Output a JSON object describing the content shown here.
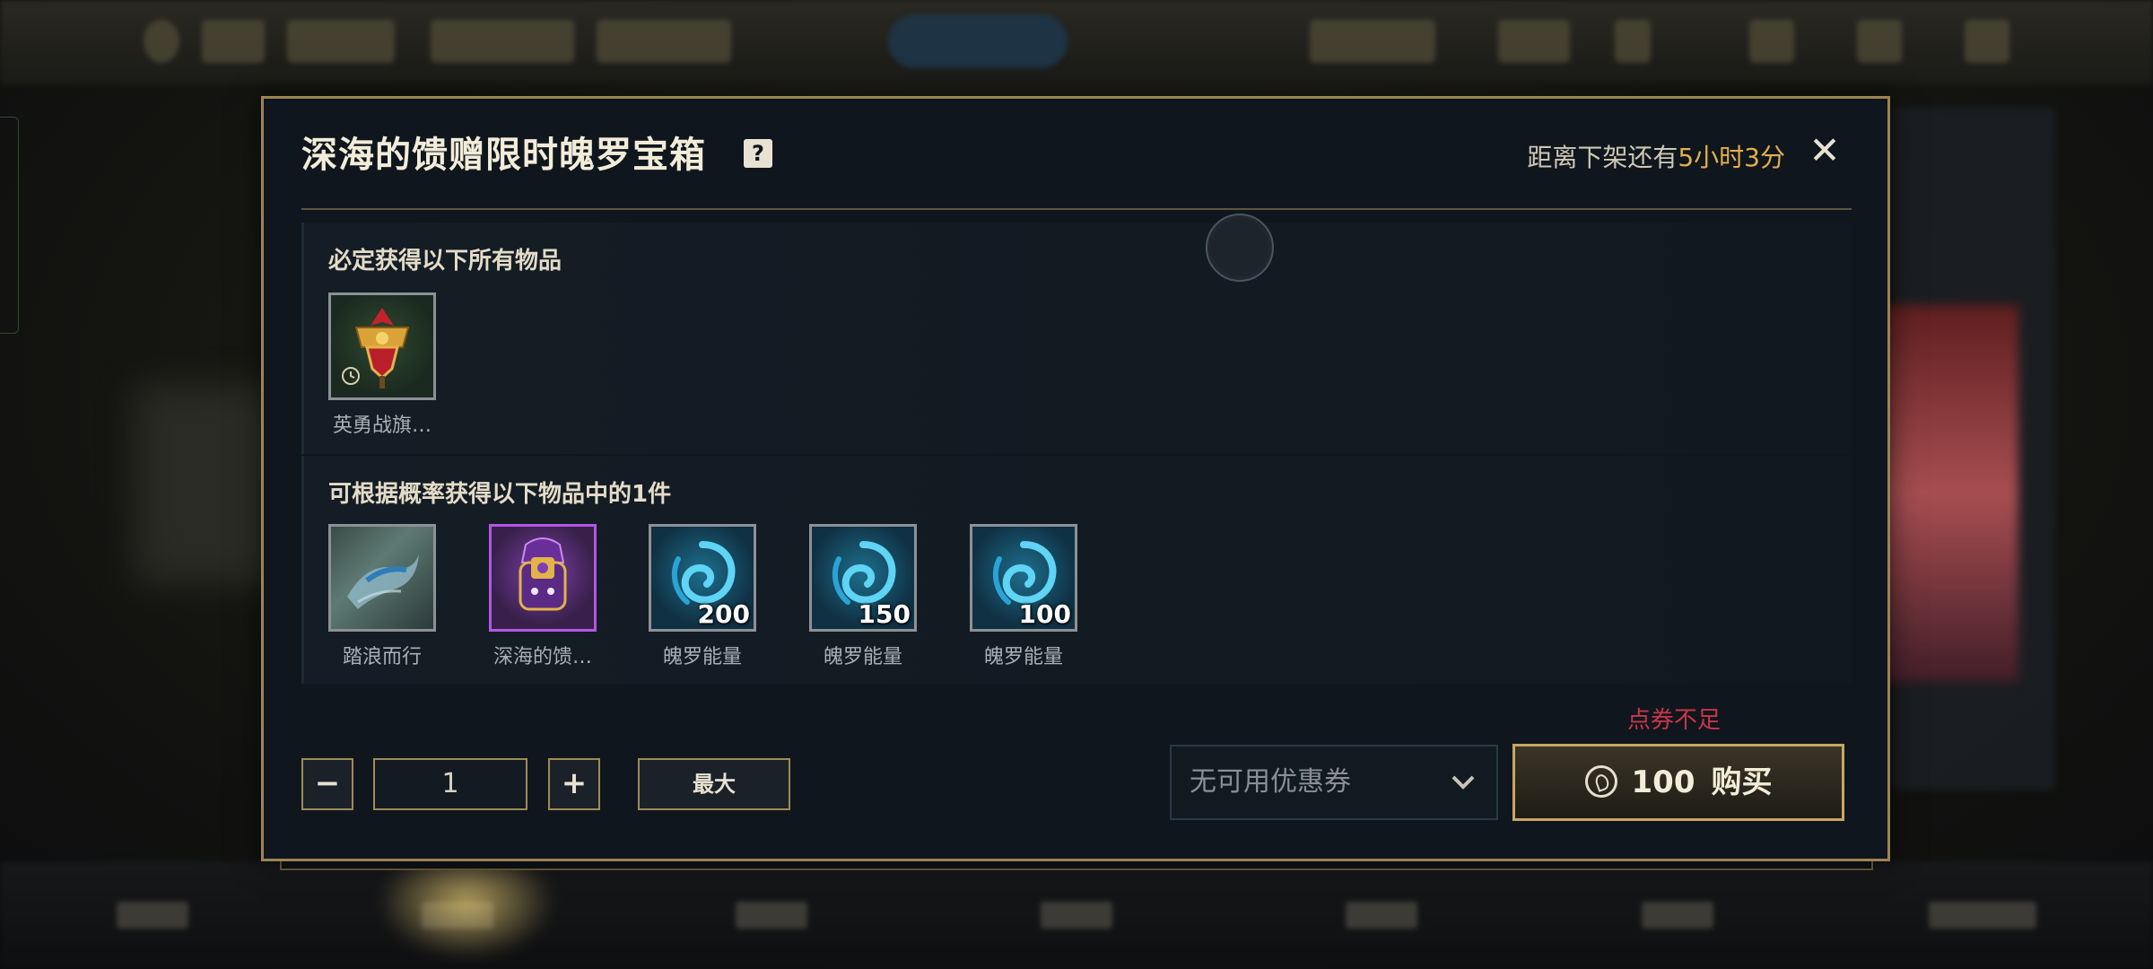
{
  "modal": {
    "title": "深海的馈赠限时魄罗宝箱",
    "help_glyph": "?",
    "timer_prefix": "距离下架还有",
    "timer_value": "5小时3分",
    "close_glyph": "✕"
  },
  "guaranteed": {
    "title": "必定获得以下所有物品",
    "items": [
      {
        "label": "英勇战旗…",
        "icon": "flag-banner-icon"
      }
    ]
  },
  "random": {
    "title": "可根据概率获得以下物品中的1件",
    "items": [
      {
        "label": "踏浪而行",
        "icon": "wave-skin-icon",
        "quantity": ""
      },
      {
        "label": "深海的馈…",
        "icon": "epic-chest-icon",
        "quantity": ""
      },
      {
        "label": "魄罗能量",
        "icon": "poro-energy-icon",
        "quantity": "200"
      },
      {
        "label": "魄罗能量",
        "icon": "poro-energy-icon",
        "quantity": "150"
      },
      {
        "label": "魄罗能量",
        "icon": "poro-energy-icon",
        "quantity": "100"
      }
    ]
  },
  "controls": {
    "minus": "−",
    "quantity": "1",
    "plus": "+",
    "max_label": "最大",
    "coupon_placeholder": "无可用优惠券",
    "warning": "点券不足",
    "price": "100",
    "buy_label": "购买"
  },
  "colors": {
    "accent_gold": "#c9a661",
    "timer_highlight": "#e3b04a",
    "warning_red": "#c9364a",
    "epic_purple": "#b257e6"
  }
}
